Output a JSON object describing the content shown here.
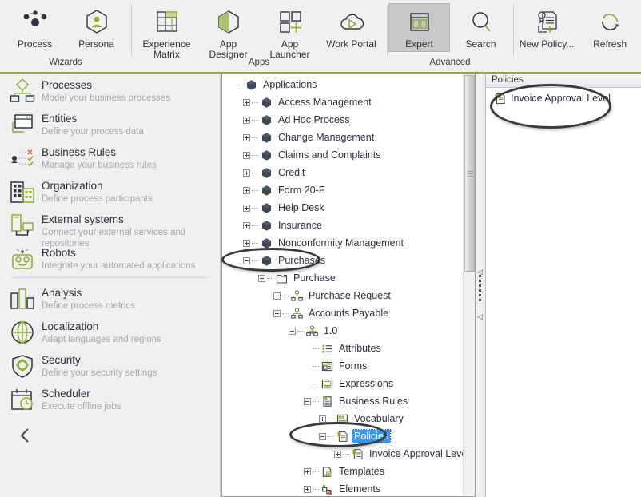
{
  "ribbon": {
    "groups": [
      {
        "label": "Wizards",
        "items": [
          {
            "label": "Process",
            "icon": "process-icon",
            "selected": false
          },
          {
            "label": "Persona",
            "icon": "persona-icon",
            "selected": false
          }
        ]
      },
      {
        "label": "Apps",
        "items": [
          {
            "label": "Experience\nMatrix",
            "icon": "experience-matrix-icon",
            "selected": false
          },
          {
            "label": "App Designer",
            "icon": "app-designer-icon",
            "selected": false
          },
          {
            "label": "App Launcher",
            "icon": "app-launcher-icon",
            "selected": false
          },
          {
            "label": "Work Portal",
            "icon": "work-portal-icon",
            "selected": false
          }
        ]
      },
      {
        "label": "Advanced",
        "items": [
          {
            "label": "Expert",
            "icon": "expert-icon",
            "selected": true
          },
          {
            "label": "Search",
            "icon": "search-icon",
            "selected": false
          }
        ]
      },
      {
        "label": "",
        "items": [
          {
            "label": "New Policy...",
            "icon": "new-policy-icon",
            "selected": false
          },
          {
            "label": "Refresh",
            "icon": "refresh-icon",
            "selected": false
          }
        ]
      }
    ]
  },
  "sidebar": {
    "items": [
      {
        "title": "Processes",
        "subtitle": "Model your business processes",
        "icon": "processes-icon"
      },
      {
        "title": "Entities",
        "subtitle": "Define your process data",
        "icon": "entities-icon"
      },
      {
        "title": "Business Rules",
        "subtitle": "Manage your business rules",
        "icon": "business-rules-icon"
      },
      {
        "title": "Organization",
        "subtitle": "Define process participants",
        "icon": "organization-icon"
      },
      {
        "title": "External systems",
        "subtitle": "Connect your external services and repositories",
        "icon": "external-systems-icon"
      },
      {
        "title": "Robots",
        "subtitle": "Integrate your automated applications",
        "icon": "robots-icon"
      }
    ],
    "items2": [
      {
        "title": "Analysis",
        "subtitle": "Define process metrics",
        "icon": "analysis-icon"
      },
      {
        "title": "Localization",
        "subtitle": "Adapt languages and regions",
        "icon": "localization-icon"
      },
      {
        "title": "Security",
        "subtitle": "Define your security settings",
        "icon": "security-icon"
      },
      {
        "title": "Scheduler",
        "subtitle": "Execute offline jobs",
        "icon": "scheduler-icon"
      }
    ],
    "collapse_icon": "chevron-left-icon"
  },
  "tree": {
    "nodes": [
      {
        "label": "Applications",
        "depth": 0,
        "expander": "none",
        "icon": "application-cube-icon",
        "selected": false
      },
      {
        "label": "Access Management",
        "depth": 1,
        "expander": "plus",
        "icon": "application-cube-icon",
        "selected": false
      },
      {
        "label": "Ad Hoc Process",
        "depth": 1,
        "expander": "plus",
        "icon": "application-cube-icon",
        "selected": false
      },
      {
        "label": "Change Management",
        "depth": 1,
        "expander": "plus",
        "icon": "application-cube-icon",
        "selected": false
      },
      {
        "label": "Claims and Complaints",
        "depth": 1,
        "expander": "plus",
        "icon": "application-cube-icon",
        "selected": false
      },
      {
        "label": "Credit",
        "depth": 1,
        "expander": "plus",
        "icon": "application-cube-icon",
        "selected": false
      },
      {
        "label": "Form 20-F",
        "depth": 1,
        "expander": "plus",
        "icon": "application-cube-icon",
        "selected": false
      },
      {
        "label": "Help Desk",
        "depth": 1,
        "expander": "plus",
        "icon": "application-cube-icon",
        "selected": false
      },
      {
        "label": "Insurance",
        "depth": 1,
        "expander": "plus",
        "icon": "application-cube-icon",
        "selected": false
      },
      {
        "label": "Nonconformity Management",
        "depth": 1,
        "expander": "plus",
        "icon": "application-cube-icon",
        "selected": false
      },
      {
        "label": "Purchases",
        "depth": 1,
        "expander": "minus",
        "icon": "application-cube-icon",
        "selected": false
      },
      {
        "label": "Purchase",
        "depth": 2,
        "expander": "minus",
        "icon": "folder-icon",
        "selected": false
      },
      {
        "label": "Purchase Request",
        "depth": 3,
        "expander": "plus",
        "icon": "process-node-icon",
        "selected": false
      },
      {
        "label": "Accounts Payable",
        "depth": 3,
        "expander": "minus",
        "icon": "process-node-icon",
        "selected": false
      },
      {
        "label": "1.0",
        "depth": 4,
        "expander": "minus",
        "icon": "version-node-icon",
        "selected": false
      },
      {
        "label": "Attributes",
        "depth": 5,
        "expander": "none",
        "icon": "attributes-icon",
        "selected": false
      },
      {
        "label": "Forms",
        "depth": 5,
        "expander": "none",
        "icon": "forms-icon",
        "selected": false
      },
      {
        "label": "Expressions",
        "depth": 5,
        "expander": "none",
        "icon": "expressions-icon",
        "selected": false
      },
      {
        "label": "Business Rules",
        "depth": 5,
        "expander": "minus",
        "icon": "business-rules-node-icon",
        "selected": false
      },
      {
        "label": "Vocabulary",
        "depth": 6,
        "expander": "plus",
        "icon": "vocabulary-icon",
        "selected": false
      },
      {
        "label": "Policies",
        "depth": 6,
        "expander": "minus",
        "icon": "policies-icon",
        "selected": true
      },
      {
        "label": "Invoice Approval Level",
        "depth": 7,
        "expander": "plus",
        "icon": "policies-icon",
        "selected": false
      },
      {
        "label": "Templates",
        "depth": 5,
        "expander": "plus",
        "icon": "templates-icon",
        "selected": false
      },
      {
        "label": "Elements",
        "depth": 5,
        "expander": "plus",
        "icon": "elements-icon",
        "selected": false
      }
    ]
  },
  "right_panel": {
    "header": "Policies",
    "items": [
      {
        "label": "Invoice Approval Level",
        "icon": "policies-icon"
      }
    ]
  },
  "annotations": [
    {
      "name": "purchases-highlight"
    },
    {
      "name": "policies-highlight"
    },
    {
      "name": "invoice-approval-level-highlight"
    }
  ],
  "colors": {
    "accent_green": "#8cb02c",
    "dark_navy": "#3c4857",
    "selection_blue": "#3399ff",
    "chrome_gray": "#f0f0f0",
    "muted_text": "#a7a7ad"
  }
}
